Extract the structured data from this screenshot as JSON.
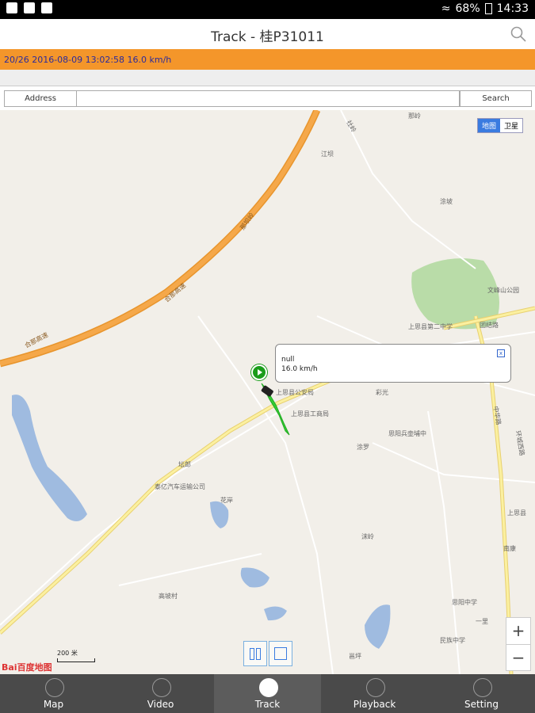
{
  "statusbar": {
    "battery": "68%",
    "time": "14:33"
  },
  "header": {
    "title": "Track - 桂P31011",
    "search_icon": "search-icon"
  },
  "info": {
    "text": "20/26  2016-08-09 13:02:58  16.0 km/h"
  },
  "address": {
    "label": "Address",
    "value": "",
    "search_label": "Search"
  },
  "map": {
    "type_map": "地图",
    "type_satellite": "卫星",
    "labels": [
      "江坝",
      "涂坡",
      "那岭",
      "社岭",
      "合那高速",
      "那坝岭",
      "合那高速",
      "文峰山公园",
      "团结路",
      "上思县第二中学",
      "思阳兵壶埔中",
      "上思县公安局",
      "上思县工商局",
      "彩光",
      "涂罗",
      "泰亿汽车运输公司",
      "坛郎",
      "花岸",
      "沫岭",
      "思阳中学",
      "一里",
      "民族中学",
      "邕坪",
      "高坡村",
      "中华路",
      "环城西路",
      "上思县",
      "南康"
    ],
    "popup_name": "null",
    "popup_speed": "16.0 km/h",
    "close_glyph": "x",
    "scale": "200 米",
    "logo": "Bai百度地图",
    "zoom_in": "+",
    "zoom_out": "−"
  },
  "tabs": [
    {
      "label": "Map",
      "icon": "globe-icon"
    },
    {
      "label": "Video",
      "icon": "play-circle-icon"
    },
    {
      "label": "Track",
      "icon": "location-pin-icon",
      "active": true
    },
    {
      "label": "Playback",
      "icon": "playback-icon"
    },
    {
      "label": "Setting",
      "icon": "gear-icon"
    }
  ],
  "colors": {
    "accent": "#f4962a",
    "info_text": "#2b2b9c",
    "road_main": "#f5a84a",
    "road_minor": "#ffffff",
    "water": "#9fbbe0",
    "park": "#b9dca8",
    "track": "#33cc33"
  }
}
